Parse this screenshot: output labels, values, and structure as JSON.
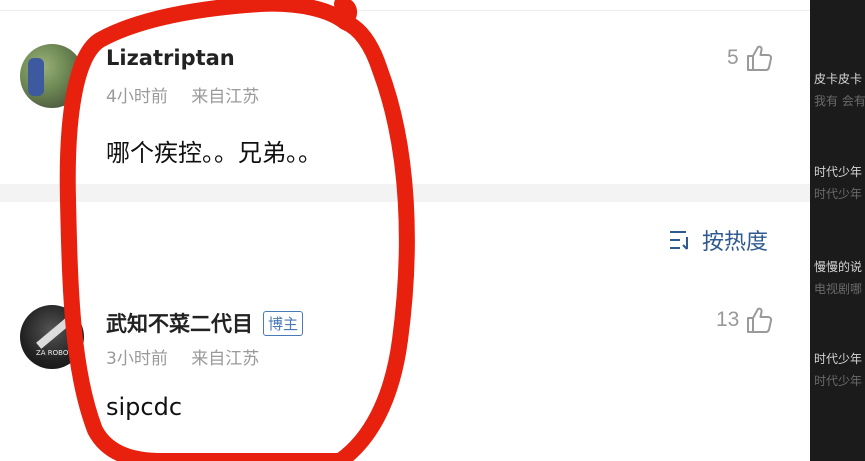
{
  "comments": [
    {
      "username": "Lizatriptan",
      "time": "4小时前",
      "location": "来自江苏",
      "text": "哪个疾控。。兄弟。。",
      "likes": "5"
    },
    {
      "username": "武知不菜二代目",
      "badge": "博主",
      "time": "3小时前",
      "location": "来自江苏",
      "text": "sipcdc",
      "likes": "13"
    }
  ],
  "sort": {
    "label": "按热度"
  },
  "side_panel": {
    "items": [
      {
        "title": "皮卡皮卡",
        "sub": "我有 会有"
      },
      {
        "title": "时代少年",
        "sub": "时代少年"
      },
      {
        "title": "慢慢的说",
        "sub": "电视剧哪"
      },
      {
        "title": "时代少年",
        "sub": "时代少年"
      }
    ]
  },
  "colors": {
    "annotation_red": "#e8200e",
    "link_blue": "#2f5a8f",
    "badge_blue": "#4a7ab8",
    "side_dark": "#1b1b1b"
  }
}
